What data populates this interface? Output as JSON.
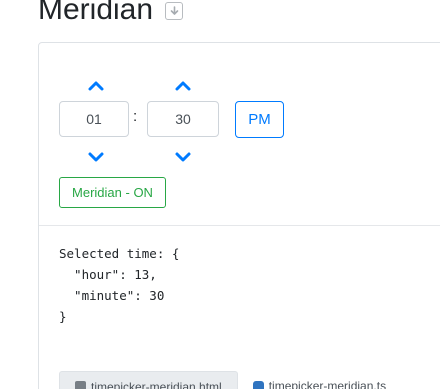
{
  "heading": {
    "title": "Meridian",
    "download_icon": "download-icon"
  },
  "timepicker": {
    "hours": "01",
    "minutes": "30",
    "separator": ":",
    "meridian": "PM",
    "chevron_up_icon": "chevron-up-icon",
    "chevron_down_icon": "chevron-down-icon",
    "accent_color": "#007bff"
  },
  "toggle": {
    "label": "Meridian - ON",
    "color": "#28a745"
  },
  "output": {
    "text": "Selected time: {\n  \"hour\": 13,\n  \"minute\": 30\n}"
  },
  "tabs": [
    {
      "label": "timepicker-meridian.html",
      "icon": "html-file-icon",
      "active": true
    },
    {
      "label": "timepicker-meridian.ts",
      "icon": "typescript-file-icon",
      "active": false
    }
  ]
}
